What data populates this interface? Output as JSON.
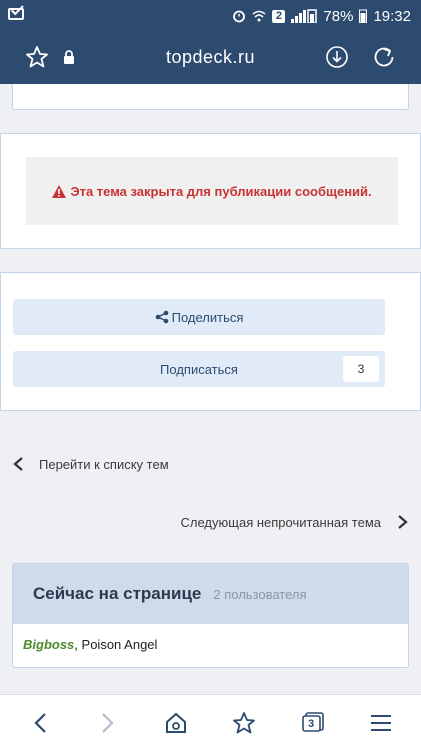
{
  "status_bar": {
    "battery": "78%",
    "time": "19:32",
    "notif_badge": "2"
  },
  "browser": {
    "url": "topdeck.ru",
    "tab_count": "3"
  },
  "notice": {
    "text": "Эта тема закрыта для публикации сообщений."
  },
  "actions": {
    "share_label": "Поделиться",
    "subscribe_label": "Подписаться",
    "subscribe_count": "3"
  },
  "navigation": {
    "back_to_list": "Перейти к списку тем",
    "next_unread": "Следующая непрочитанная тема"
  },
  "online": {
    "title": "Сейчас на странице",
    "count": "2 пользователя",
    "user1": "Bigboss",
    "separator": ", ",
    "user2": "Poison Angel"
  },
  "colors": {
    "topbar": "#2d4a6f",
    "notice_red": "#c93333",
    "button_bg": "#e0ebf7",
    "online_head": "#cfdbea"
  }
}
